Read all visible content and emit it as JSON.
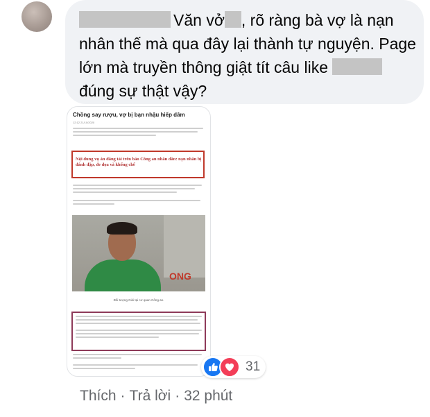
{
  "comment": {
    "text_part1": "Văn vở",
    "text_part2": ", rõ ràng bà vợ là nạn nhân thế mà qua đây lại thành tự nguyện. Page lớn mà truyền thông giật tít câu like",
    "text_part3": "đúng sự thật vậy?"
  },
  "attachment": {
    "article_title": "Chồng say rượu, vợ bị bạn nhậu hiếp dâm",
    "article_date": "12:12 21/10/2020",
    "highlight_text": "Nội dung vụ án đăng tải trên báo Công an nhân dân: nạn nhân bị đánh đập, đe dọa và khống chế",
    "photo_caption": "Đối tượng Giỏi tại cơ quan Công an."
  },
  "reactions": {
    "count": "31",
    "types": [
      "like-icon",
      "love-icon"
    ],
    "colors": {
      "like": "#1877f2",
      "love": "#f33e58"
    }
  },
  "actions": {
    "like_label": "Thích",
    "reply_label": "Trả lời",
    "separator": "·",
    "time": "32 phút"
  }
}
